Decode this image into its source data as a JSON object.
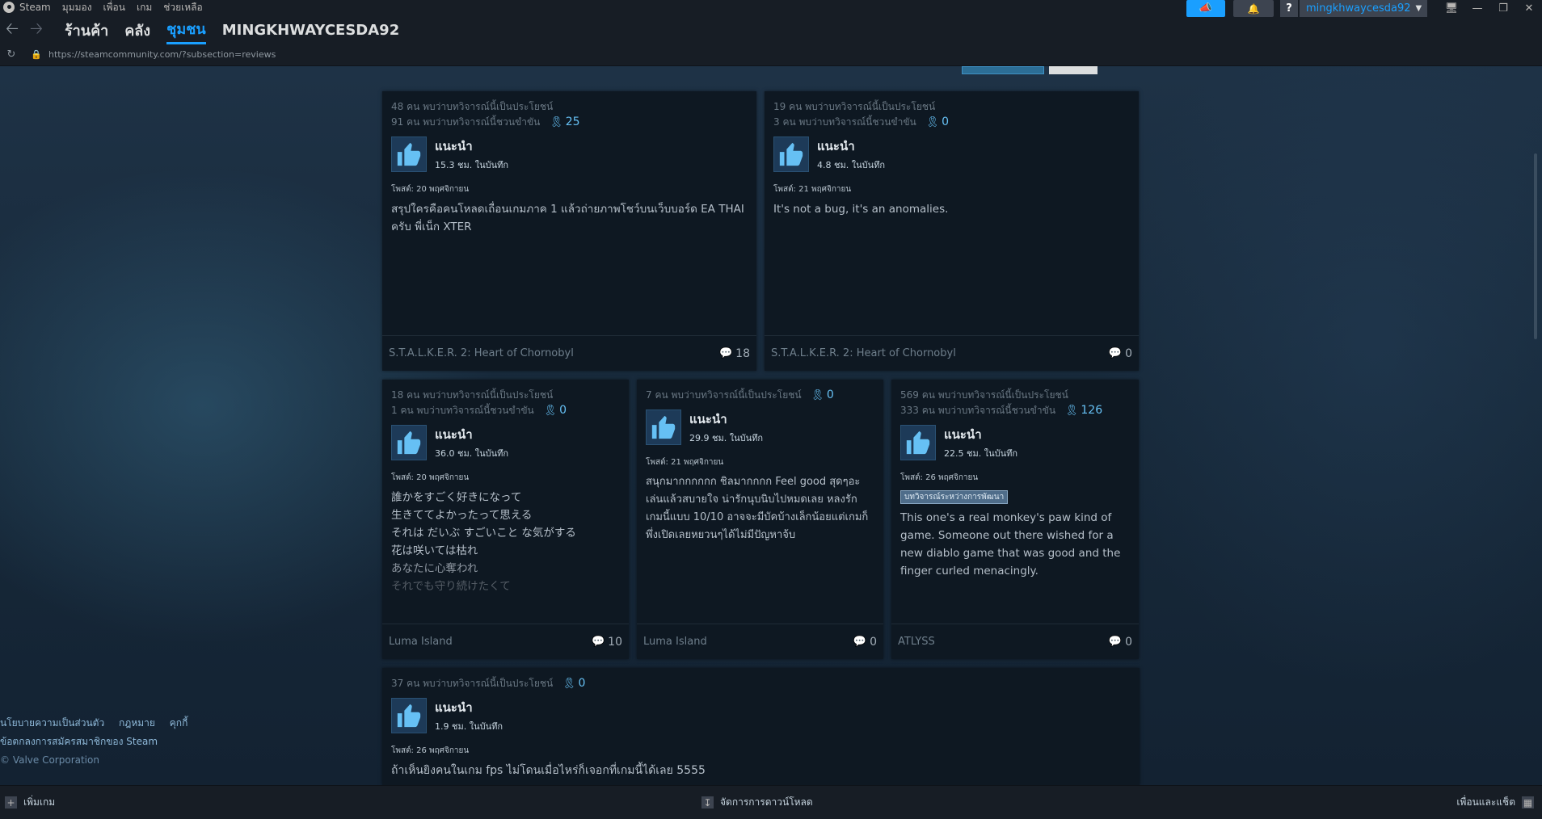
{
  "menu": {
    "app_name": "Steam",
    "items": [
      "มุมมอง",
      "เพื่อน",
      "เกม",
      "ช่วยเหลือ"
    ]
  },
  "nav": {
    "store": "ร้านค้า",
    "library": "คลัง",
    "community": "ชุมชน",
    "username": "MINGKHWAYCESDA92"
  },
  "address_bar": {
    "url": "https://steamcommunity.com/?subsection=reviews"
  },
  "account": {
    "name": "mingkhwaycesda92"
  },
  "colors": {
    "accent": "#1a9fff",
    "background": "#1b2838",
    "card": "#0e1822"
  },
  "reviews": [
    {
      "helpful": "48 คน พบว่าบทวิจารณ์นี้เป็นประโยชน์",
      "funny": "91 คน พบว่าบทวิจารณ์นี้ชวนขำขัน",
      "awards": "25",
      "recommendation": "แนะนำ",
      "hours": "15.3 ชม. ในบันทึก",
      "posted": "โพสต์: 20 พฤศจิกายน",
      "lines": [
        "สรุปใครคือคนโหลดเถื่อนเกมภาค 1 แล้วถ่ายภาพโชว์บนเว็บบอร์ด EA THAI",
        "ครับ พี่เน็ก XTER"
      ],
      "game": "S.T.A.L.K.E.R. 2: Heart of Chornobyl",
      "comments": "18"
    },
    {
      "helpful": "19 คน พบว่าบทวิจารณ์นี้เป็นประโยชน์",
      "funny": "3 คน พบว่าบทวิจารณ์นี้ชวนขำขัน",
      "awards": "0",
      "recommendation": "แนะนำ",
      "hours": "4.8 ชม. ในบันทึก",
      "posted": "โพสต์: 21 พฤศจิกายน",
      "lines": [
        "It's not a bug, it's an anomalies."
      ],
      "game": "S.T.A.L.K.E.R. 2: Heart of Chornobyl",
      "comments": "0"
    },
    {
      "helpful": "18 คน พบว่าบทวิจารณ์นี้เป็นประโยชน์",
      "funny": "1 คน พบว่าบทวิจารณ์นี้ชวนขำขัน",
      "awards": "0",
      "recommendation": "แนะนำ",
      "hours": "36.0 ชม. ในบันทึก",
      "posted": "โพสต์: 20 พฤศจิกายน",
      "lines": [
        "誰かをすごく好きになって",
        "生きててよかったって思える",
        "それは だいぶ すごいこと な気がする",
        "花は咲いては枯れ",
        "あなたに心奪われ",
        "それでも守り続けたくて"
      ],
      "game": "Luma Island",
      "comments": "10"
    },
    {
      "helpful": "7 คน พบว่าบทวิจารณ์นี้เป็นประโยชน์",
      "awards": "0",
      "recommendation": "แนะนำ",
      "hours": "29.9 ชม. ในบันทึก",
      "posted": "โพสต์: 21 พฤศจิกายน",
      "lines": [
        "สนุกมากกกกกก ชิลมากกกก Feel good สุดๆอะ",
        "เล่นแล้วสบายใจ น่ารักนุบนิบไปหมดเลย หลงรัก",
        "เกมนี้แบบ 10/10 อาจจะมีบัคบ้างเล็กน้อยแต่เกมก็",
        "พึ่งเปิดเลยหยวนๆได้ไม่มีปัญหาจ้บ"
      ],
      "game": "Luma Island",
      "comments": "0"
    },
    {
      "helpful": "569 คน พบว่าบทวิจารณ์นี้เป็นประโยชน์",
      "funny": "333 คน พบว่าบทวิจารณ์นี้ชวนขำขัน",
      "awards": "126",
      "recommendation": "แนะนำ",
      "hours": "22.5 ชม. ในบันทึก",
      "posted": "โพสต์: 26 พฤศจิกายน",
      "badge": "บทวิจารณ์ระหว่างการพัฒนา",
      "lines": [
        "This one's a real monkey's paw kind of",
        "game. Someone out there wished for a",
        "new diablo game that was good and the",
        "finger curled menacingly."
      ],
      "game": "ATLYSS",
      "comments": "0"
    },
    {
      "helpful": "37 คน พบว่าบทวิจารณ์นี้เป็นประโยชน์",
      "awards": "0",
      "recommendation": "แนะนำ",
      "hours": "1.9 ชม. ในบันทึก",
      "posted": "โพสต์: 26 พฤศจิกายน",
      "lines": [
        "ถ้าเห็นยิงคนในเกม fps ไม่โดนเมื่อไหร่ก็เจอกที่เกมนี้ได้เลย 5555"
      ]
    }
  ],
  "legal": {
    "privacy": "นโยบายความเป็นส่วนตัว",
    "legal": "กฎหมาย",
    "cookies": "คุกกี้",
    "ssa": "ข้อตกลงการสมัครสมาชิกของ Steam",
    "copyright": "© Valve Corporation"
  },
  "bottom_bar": {
    "add_game": "เพิ่มเกม",
    "downloads": "จัดการการดาวน์โหลด",
    "friends": "เพื่อนและแช็ต"
  },
  "icons": [
    "steam-logo-icon",
    "back-arrow-icon",
    "forward-arrow-icon",
    "reload-icon",
    "lock-icon",
    "megaphone-icon",
    "bell-icon",
    "help-icon",
    "chevron-down-icon",
    "monitor-icon",
    "minimize-icon",
    "restore-icon",
    "close-icon",
    "award-ribbon-icon",
    "thumbs-up-icon",
    "comment-bubble-icon",
    "add-icon",
    "download-icon",
    "friends-icon"
  ]
}
